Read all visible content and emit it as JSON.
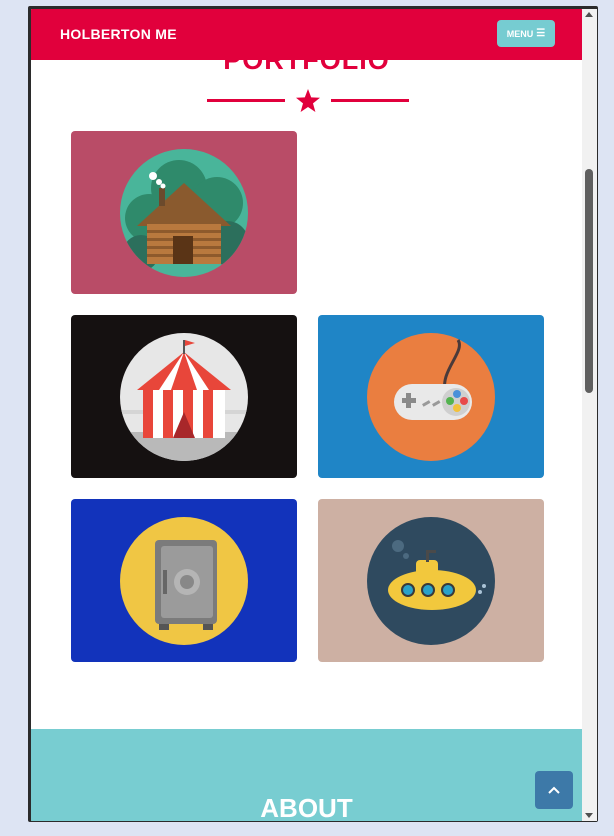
{
  "navbar": {
    "brand": "HOLBERTON ME",
    "menu_label": "MENU"
  },
  "portfolio": {
    "title": "PORTFOLIO",
    "items": [
      {
        "name": "cabin",
        "icon": "log-cabin-icon",
        "bg": "#b94c67",
        "circle": "#49b59a"
      },
      {
        "name": "circus",
        "icon": "circus-tent-icon",
        "bg": "#151111",
        "circle": "#e7e7e7"
      },
      {
        "name": "game",
        "icon": "game-controller-icon",
        "bg": "#1f85c6",
        "circle": "#ea7e40"
      },
      {
        "name": "safe",
        "icon": "safe-icon",
        "bg": "#1233bb",
        "circle": "#f0c644"
      },
      {
        "name": "submarine",
        "icon": "submarine-icon",
        "bg": "#cdb0a3",
        "circle": "#2f4a5f"
      }
    ]
  },
  "about": {
    "title": "ABOUT"
  },
  "colors": {
    "brand_red": "#e1003c",
    "teal": "#78cdd1",
    "to_top_button": "#3d79a8"
  },
  "controls": {
    "to_top_icon": "chevron-up-icon"
  }
}
